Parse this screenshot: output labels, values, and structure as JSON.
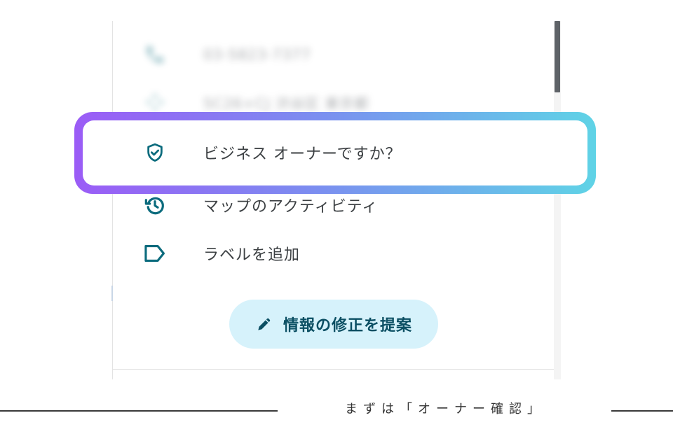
{
  "panel": {
    "rows": [
      {
        "label": "03-5823-7377",
        "icon": "phone-icon"
      },
      {
        "label": "5C26+CJ 渋谷区 東京都",
        "icon": "plus-code-icon"
      },
      {
        "label": "ビジネス オーナーですか？",
        "icon": "verified-shield-icon"
      },
      {
        "label": "マップのアクティビティ",
        "icon": "history-icon"
      },
      {
        "label": "ラベルを追加",
        "icon": "label-icon"
      }
    ],
    "suggest_button": {
      "label": "情報の修正を提案",
      "icon": "pencil-icon"
    }
  },
  "caption": {
    "text": "まずは「オーナー確認」"
  },
  "colors": {
    "icon_teal": "#0b6b7d",
    "button_bg": "#d6f2fb",
    "button_text": "#0b4f63",
    "highlight_start": "#9b5cf6",
    "highlight_end": "#5fd3e6",
    "scroll_thumb": "#5f6368"
  }
}
